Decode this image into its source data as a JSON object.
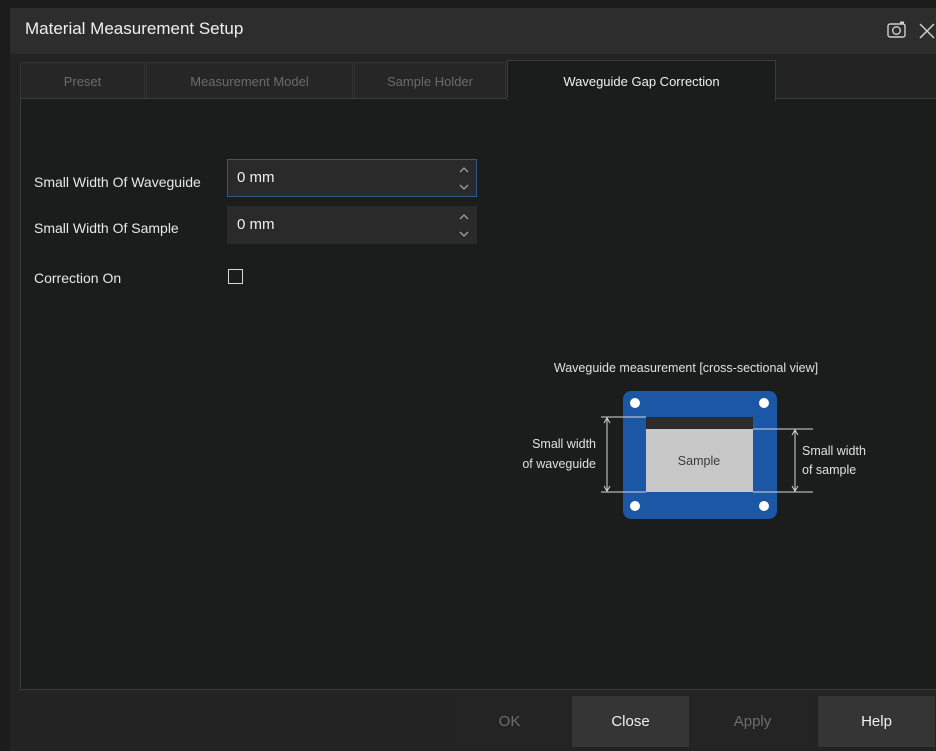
{
  "window": {
    "title": "Material Measurement Setup"
  },
  "tabs": [
    {
      "label": "Preset"
    },
    {
      "label": "Measurement Model"
    },
    {
      "label": "Sample Holder"
    },
    {
      "label": "Waveguide Gap Correction"
    }
  ],
  "active_tab": "Waveguide Gap Correction",
  "form": {
    "waveguide_width": {
      "label": "Small Width Of Waveguide",
      "value": "0 mm"
    },
    "sample_width": {
      "label": "Small Width Of Sample",
      "value": "0 mm"
    },
    "correction": {
      "label": "Correction On",
      "checked": false
    }
  },
  "diagram": {
    "title": "Waveguide measurement [cross-sectional view]",
    "left_label_line1": "Small width",
    "left_label_line2": "of waveguide",
    "right_label_line1": "Small width",
    "right_label_line2": "of sample",
    "sample_label": "Sample",
    "colors": {
      "flange": "#1c57a5",
      "sample": "#c8c8c8",
      "gap": "#2c2c2c"
    }
  },
  "footer": {
    "ok_label": "OK",
    "close_label": "Close",
    "apply_label": "Apply",
    "help_label": "Help"
  },
  "icons": [
    "camera-icon",
    "close-icon",
    "chevron-up-icon",
    "chevron-down-icon"
  ]
}
